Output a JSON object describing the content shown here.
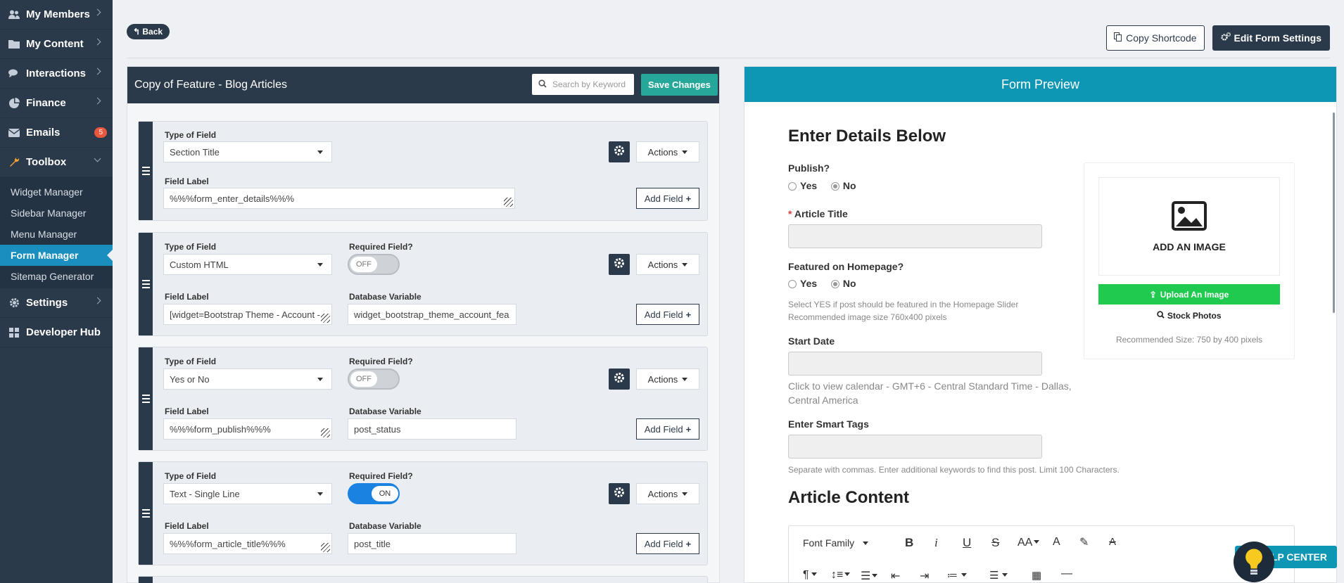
{
  "sidebar": {
    "items": [
      {
        "label": "My Members",
        "icon": "users-icon"
      },
      {
        "label": "My Content",
        "icon": "folder-icon"
      },
      {
        "label": "Interactions",
        "icon": "comments-icon"
      },
      {
        "label": "Finance",
        "icon": "pie-chart-icon"
      },
      {
        "label": "Emails",
        "icon": "envelope-icon",
        "badge": "5"
      },
      {
        "label": "Toolbox",
        "icon": "wrench-icon"
      }
    ],
    "toolbox_sub": [
      "Widget Manager",
      "Sidebar Manager",
      "Menu Manager",
      "Form Manager",
      "Sitemap Generator"
    ],
    "items_after": [
      {
        "label": "Settings",
        "icon": "gear-icon"
      },
      {
        "label": "Developer Hub",
        "icon": "grid-icon"
      }
    ]
  },
  "header": {
    "back": "Back",
    "copy_shortcode": "Copy Shortcode",
    "edit_form_settings": "Edit Form Settings"
  },
  "builder": {
    "title": "Copy of Feature - Blog Articles",
    "search_placeholder": "Search by Keyword",
    "save": "Save Changes",
    "labels": {
      "type_of_field": "Type of Field",
      "field_label": "Field Label",
      "required": "Required Field?",
      "db_var": "Database Variable",
      "actions": "Actions",
      "add_field": "Add Field"
    },
    "fields": [
      {
        "type": "Section Title",
        "label": "%%%form_enter_details%%%"
      },
      {
        "type": "Custom HTML",
        "label": "[widget=Bootstrap Theme - Account - ",
        "required": "OFF",
        "db": "widget_bootstrap_theme_account_fea"
      },
      {
        "type": "Yes or No",
        "label": "%%%form_publish%%%",
        "required": "OFF",
        "db": "post_status"
      },
      {
        "type": "Text - Single Line",
        "label": "%%%form_article_title%%%",
        "required": "ON",
        "db": "post_title"
      }
    ]
  },
  "preview": {
    "title": "Form Preview",
    "heading": "Enter Details Below",
    "publish": "Publish?",
    "yes": "Yes",
    "no": "No",
    "required_star": "*",
    "article_title": "Article Title",
    "featured": "Featured on Homepage?",
    "featured_help1": "Select YES if post should be featured in the Homepage Slider",
    "featured_help2": "Recommended image size 760x400 pixels",
    "start_date": "Start Date",
    "start_help1": "Click to view calendar - GMT+6 - Central Standard Time - Dallas,",
    "start_help2": "Central America",
    "smart_tags": "Enter Smart Tags",
    "tags_help": "Separate with commas. Enter additional keywords to find this post. Limit 100 Characters.",
    "article_content": "Article Content",
    "add_image": "ADD AN IMAGE",
    "upload": "Upload An Image",
    "stock": "Stock Photos",
    "rec_size": "Recommended Size: 750 by 400 pixels",
    "font_family": "Font Family"
  },
  "help_center": "ELP CENTER"
}
